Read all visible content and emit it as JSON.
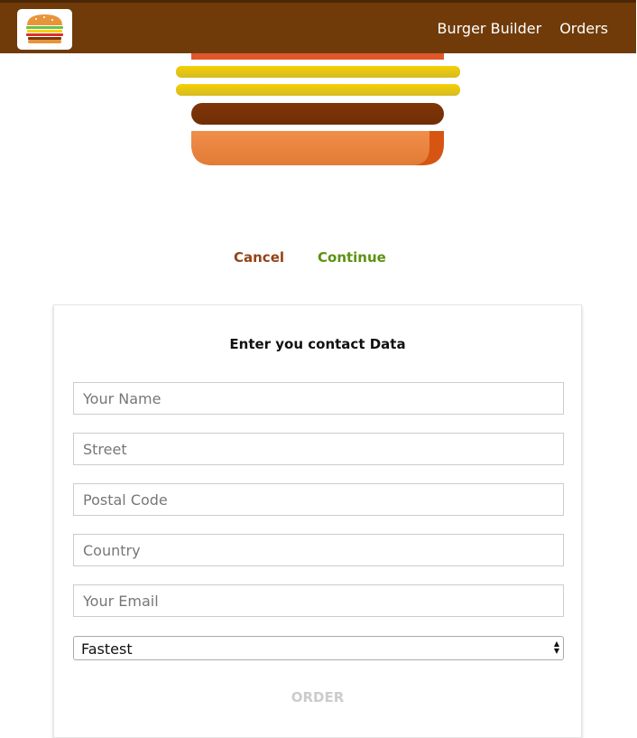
{
  "toolbar": {
    "logo_icon": "burger-logo-icon",
    "nav": [
      "Burger Builder",
      "Orders"
    ]
  },
  "modal": {
    "cancel_label": "Cancel",
    "continue_label": "Continue"
  },
  "contact": {
    "title": "Enter you contact Data",
    "fields": [
      {
        "placeholder": "Your Name",
        "value": ""
      },
      {
        "placeholder": "Street",
        "value": ""
      },
      {
        "placeholder": "Postal Code",
        "value": ""
      },
      {
        "placeholder": "Country",
        "value": ""
      },
      {
        "placeholder": "Your Email",
        "value": ""
      }
    ],
    "delivery_method": "Fastest",
    "order_label": "ORDER"
  },
  "colors": {
    "toolbar_bg": "#703B09",
    "cancel": "#944317",
    "continue": "#5C9210",
    "order_disabled": "#cccccc",
    "cheese": "#f4d004",
    "meat": "#7f3608",
    "bread_bottom": "#F08E4A"
  }
}
